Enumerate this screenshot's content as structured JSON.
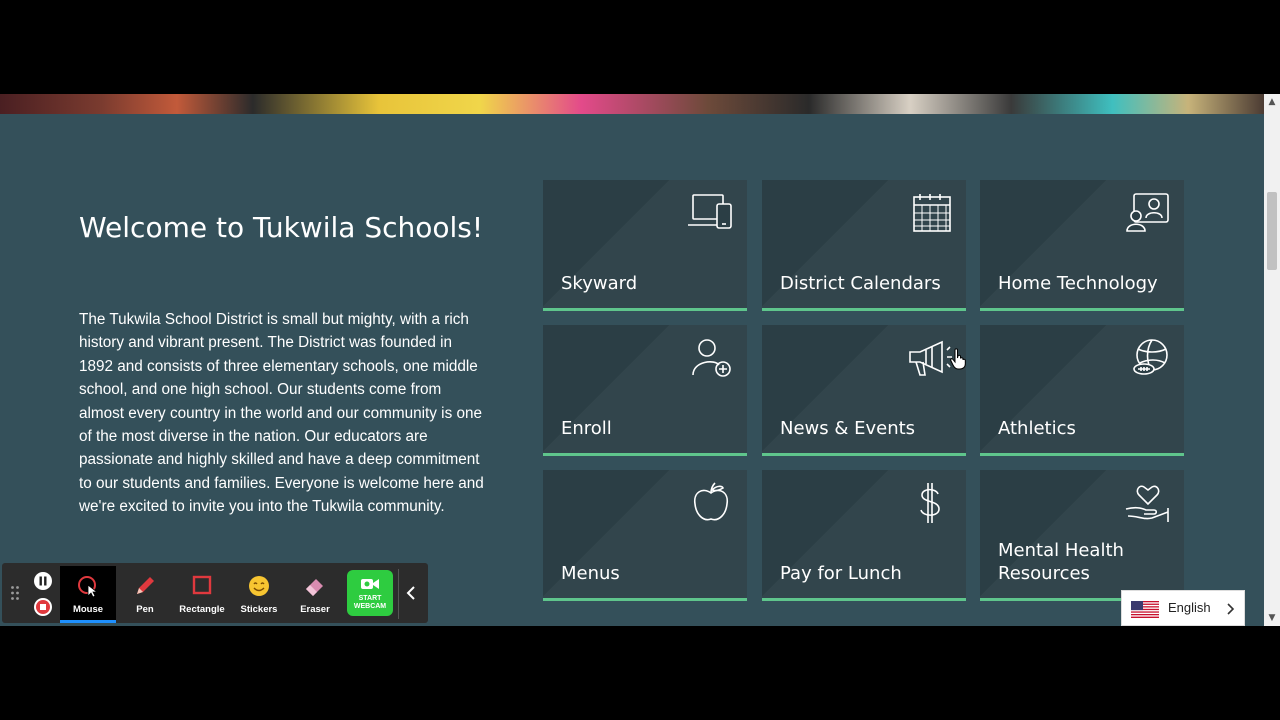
{
  "welcome": {
    "title": "Welcome to Tukwila Schools!",
    "body": "The Tukwila School District is small but mighty, with a rich history and vibrant present. The District was founded in 1892 and consists of three elementary schools, one middle school, and one high school. Our students come from almost every country in the world and our community is one of the most diverse in the nation. Our educators are passionate and highly skilled and have a deep commitment to our students and families. Everyone is welcome here and we're excited to invite you into the Tukwila community."
  },
  "tiles": [
    {
      "label": "Skyward",
      "icon": "laptop-phone-icon"
    },
    {
      "label": "District Calendars",
      "icon": "calendar-icon"
    },
    {
      "label": "Home Technology",
      "icon": "user-screen-icon"
    },
    {
      "label": "Enroll",
      "icon": "user-add-icon"
    },
    {
      "label": "News & Events",
      "icon": "megaphone-icon"
    },
    {
      "label": "Athletics",
      "icon": "sports-balls-icon"
    },
    {
      "label": "Menus",
      "icon": "apple-icon"
    },
    {
      "label": "Pay for Lunch",
      "icon": "dollar-icon"
    },
    {
      "label": "Mental Health Resources",
      "icon": "heart-hand-icon"
    }
  ],
  "recorder_toolbar": {
    "tools": [
      {
        "label": "Mouse",
        "icon": "mouse-cursor-icon"
      },
      {
        "label": "Pen",
        "icon": "pen-icon"
      },
      {
        "label": "Rectangle",
        "icon": "rectangle-icon"
      },
      {
        "label": "Stickers",
        "icon": "sticker-face-icon"
      },
      {
        "label": "Eraser",
        "icon": "eraser-icon"
      }
    ],
    "webcam_label_1": "START",
    "webcam_label_2": "WEBCAM",
    "selected_tool": "Mouse",
    "accent_color": "#1e90ff",
    "webcam_color": "#2ecc40"
  },
  "language": {
    "selected": "English",
    "flag": "us-flag-icon"
  },
  "colors": {
    "page_background": "#34505a",
    "tile_background": "#2b3e45",
    "tile_accent": "#5fc58c"
  }
}
